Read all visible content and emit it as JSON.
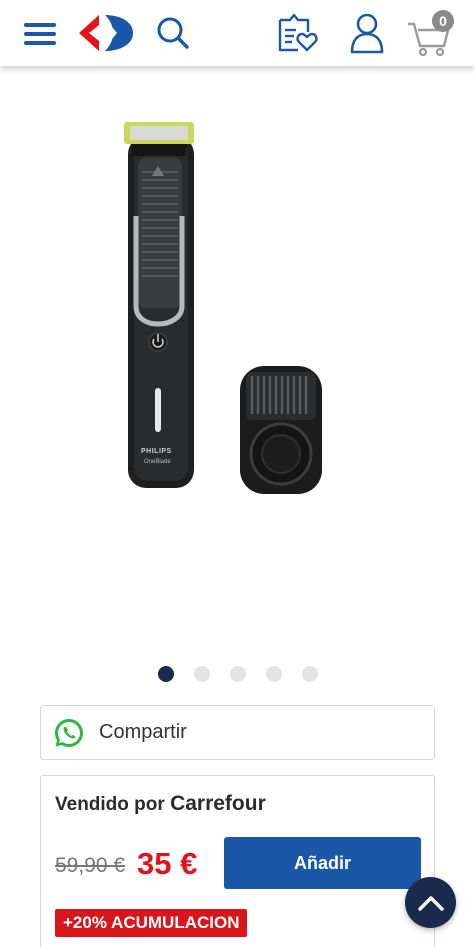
{
  "header": {
    "menu_icon": "hamburger-menu-icon",
    "logo": "carrefour-logo",
    "search_icon": "search-icon",
    "list_icon": "shopping-list-heart-icon",
    "account_icon": "user-account-icon",
    "cart_icon": "shopping-cart-icon",
    "cart_count": "0",
    "brand_blue": "#1a57a8",
    "brand_red": "#e3121b"
  },
  "product": {
    "image_label": "PHILIPS",
    "image_sublabel": "OneBlade",
    "carousel": {
      "total": 5,
      "active": 1
    }
  },
  "share": {
    "label": "Compartir",
    "icon": "whatsapp-icon"
  },
  "offer": {
    "sold_by_prefix": "Vendido por",
    "seller": "Carrefour",
    "old_price": "59,90 €",
    "price": "35 €",
    "add_button": "Añadir",
    "promo_badge": "+20% ACUMULACION"
  },
  "scroll_top_icon": "chevron-up-icon"
}
